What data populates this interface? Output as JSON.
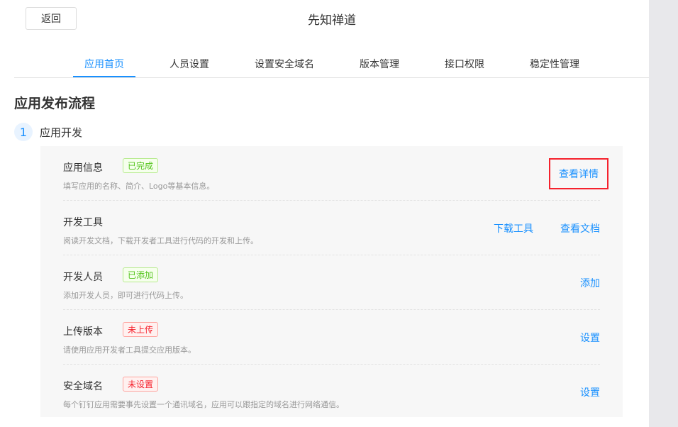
{
  "header": {
    "back_label": "返回",
    "title": "先知禅道"
  },
  "tabs": [
    {
      "label": "应用首页"
    },
    {
      "label": "人员设置"
    },
    {
      "label": "设置安全域名"
    },
    {
      "label": "版本管理"
    },
    {
      "label": "接口权限"
    },
    {
      "label": "稳定性管理"
    }
  ],
  "section_title": "应用发布流程",
  "step": {
    "number": "1",
    "label": "应用开发"
  },
  "rows": [
    {
      "title": "应用信息",
      "badge": "已完成",
      "desc": "填写应用的名称、简介、Logo等基本信息。",
      "actions": [
        "查看详情"
      ]
    },
    {
      "title": "开发工具",
      "desc": "阅读开发文档，下载开发者工具进行代码的开发和上传。",
      "actions": [
        "下载工具",
        "查看文档"
      ]
    },
    {
      "title": "开发人员",
      "badge": "已添加",
      "desc": "添加开发人员，即可进行代码上传。",
      "actions": [
        "添加"
      ]
    },
    {
      "title": "上传版本",
      "badge": "未上传",
      "desc": "请使用应用开发者工具提交应用版本。",
      "actions": [
        "设置"
      ]
    },
    {
      "title": "安全域名",
      "badge": "未设置",
      "desc": "每个钉钉应用需要事先设置一个通讯域名，应用可以跟指定的域名进行网络通信。",
      "actions": [
        "设置"
      ]
    }
  ],
  "colors": {
    "accent": "#1890ff",
    "success": "#52c41a",
    "danger": "#f5222d"
  }
}
